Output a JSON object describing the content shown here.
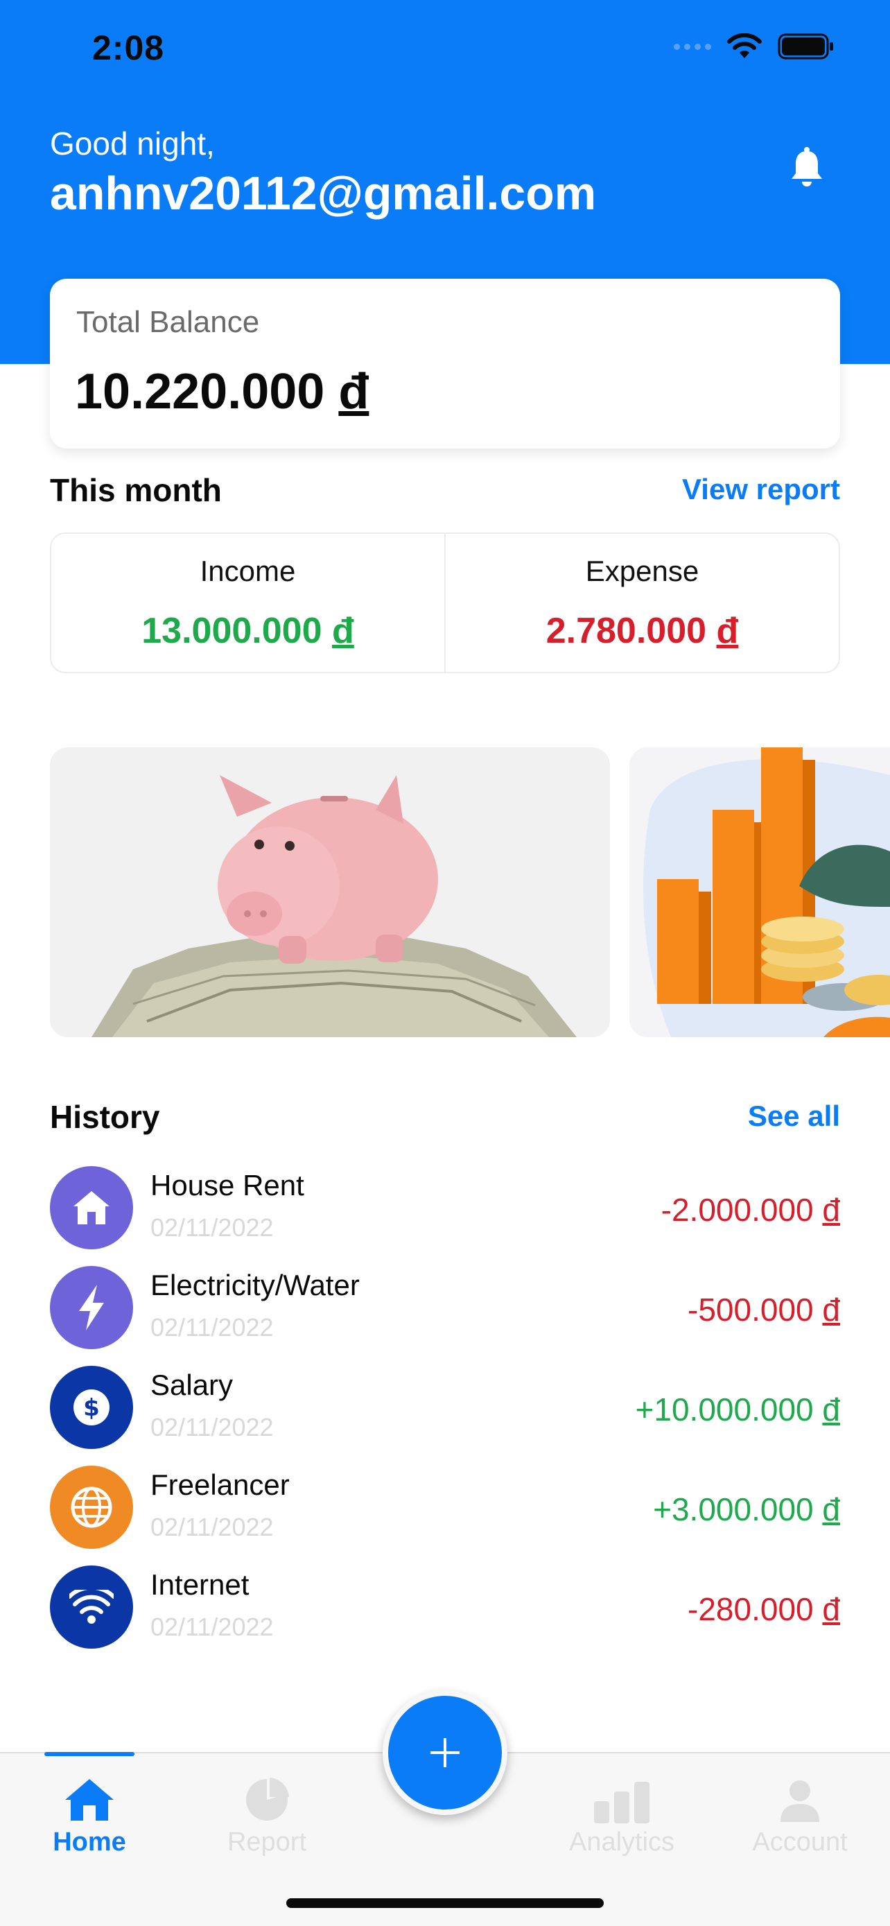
{
  "status": {
    "time": "2:08"
  },
  "header": {
    "greeting": "Good night,",
    "email": "anhnv20112@gmail.com"
  },
  "balance": {
    "label": "Total Balance",
    "amount": "10.220.000",
    "currency": "đ"
  },
  "this_month": {
    "title": "This month",
    "link": "View report",
    "income": {
      "label": "Income",
      "amount": "13.000.000",
      "currency": "đ"
    },
    "expense": {
      "label": "Expense",
      "amount": "2.780.000",
      "currency": "đ"
    }
  },
  "history": {
    "title": "History",
    "link": "See all",
    "items": [
      {
        "name": "House Rent",
        "date": "02/11/2022",
        "amount": "-2.000.000",
        "currency": "đ",
        "icon": "house-icon",
        "color": "#6e63d9",
        "type": "expense"
      },
      {
        "name": "Electricity/Water",
        "date": "02/11/2022",
        "amount": "-500.000",
        "currency": "đ",
        "icon": "lightning-icon",
        "color": "#6e63d9",
        "type": "expense"
      },
      {
        "name": "Salary",
        "date": "02/11/2022",
        "amount": "+10.000.000",
        "currency": "đ",
        "icon": "dollar-icon",
        "color": "#0b36a6",
        "type": "income"
      },
      {
        "name": "Freelancer",
        "date": "02/11/2022",
        "amount": "+3.000.000",
        "currency": "đ",
        "icon": "globe-icon",
        "color": "#f08a24",
        "type": "income"
      },
      {
        "name": "Internet",
        "date": "02/11/2022",
        "amount": "-280.000",
        "currency": "đ",
        "icon": "wifi-icon",
        "color": "#0b36a6",
        "type": "expense"
      }
    ]
  },
  "tabs": [
    {
      "label": "Home",
      "icon": "home-icon",
      "active": true
    },
    {
      "label": "Report",
      "icon": "pie-chart-icon",
      "active": false
    },
    {
      "label": "Analytics",
      "icon": "bar-chart-icon",
      "active": false
    },
    {
      "label": "Account",
      "icon": "person-icon",
      "active": false
    }
  ],
  "colors": {
    "primary": "#0a7cf7",
    "income": "#1ea94a",
    "expense": "#d61f2a"
  }
}
